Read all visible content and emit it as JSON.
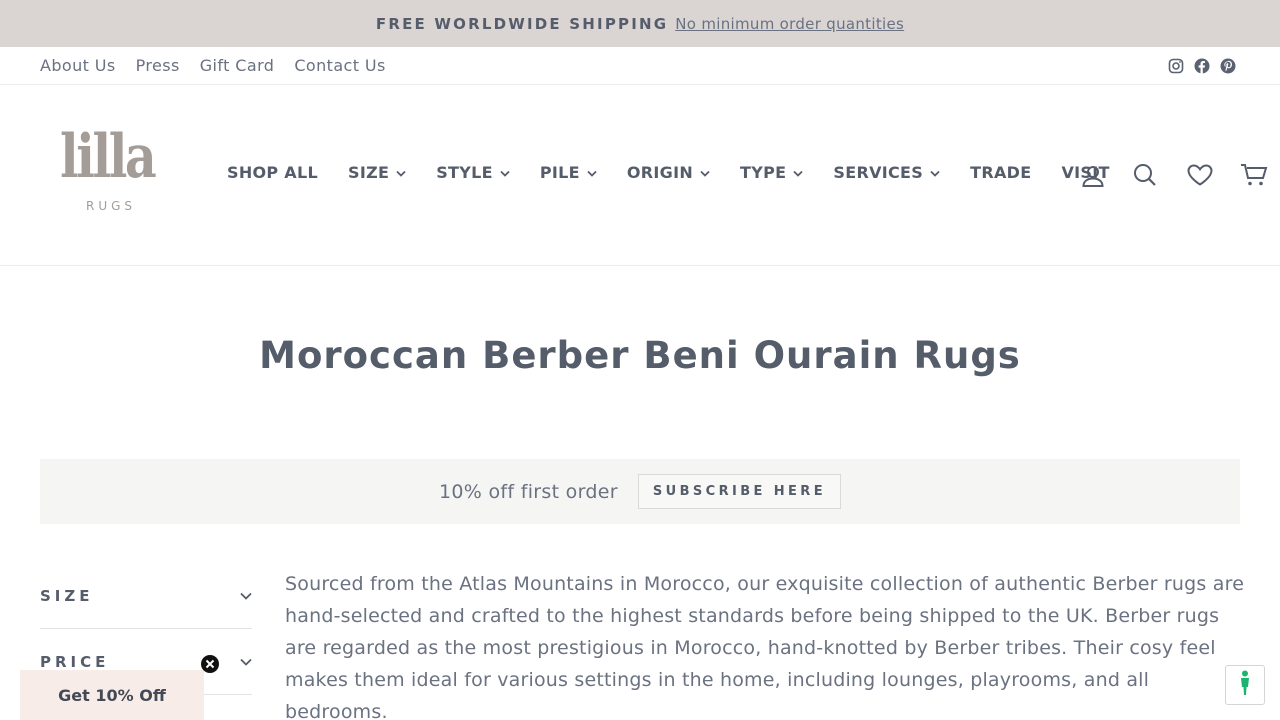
{
  "announcement": {
    "strong": "FREE WORLDWIDE SHIPPING",
    "link": "No minimum order quantities"
  },
  "utility": {
    "links": [
      "About Us",
      "Press",
      "Gift Card",
      "Contact Us"
    ],
    "social": [
      "instagram-icon",
      "facebook-icon",
      "pinterest-icon"
    ]
  },
  "logo": {
    "word": "lilla",
    "sub": "RUGS"
  },
  "nav": {
    "items": [
      {
        "label": "SHOP ALL",
        "dropdown": false
      },
      {
        "label": "SIZE",
        "dropdown": true
      },
      {
        "label": "STYLE",
        "dropdown": true
      },
      {
        "label": "PILE",
        "dropdown": true
      },
      {
        "label": "ORIGIN",
        "dropdown": true
      },
      {
        "label": "TYPE",
        "dropdown": true
      },
      {
        "label": "SERVICES",
        "dropdown": true
      },
      {
        "label": "TRADE",
        "dropdown": false
      },
      {
        "label": "VISIT",
        "dropdown": false
      }
    ],
    "icons": [
      "account-icon",
      "search-icon",
      "heart-icon",
      "cart-icon"
    ]
  },
  "page": {
    "title": "Moroccan Berber Beni Ourain Rugs"
  },
  "promo": {
    "text": "10% off first order",
    "button": "SUBSCRIBE HERE"
  },
  "filters": [
    {
      "label": "SIZE"
    },
    {
      "label": "PRICE"
    }
  ],
  "description": "Sourced from the Atlas Mountains in Morocco, our exquisite collection of authentic Berber rugs are hand-selected and crafted to the highest standards before being shipped to the UK. Berber rugs are regarded as the most prestigious in Morocco, hand-knotted by Berber tribes. Their cosy feel makes them ideal for various settings in the home, including lounges, playrooms, and all bedrooms.",
  "discount_tab": {
    "label": "Get 10% Off"
  },
  "colors": {
    "announcement_bg": "#dad5d3",
    "text": "#555c6a",
    "logo": "#a39c97",
    "promo_bg": "#f5f5f4",
    "discount_bg": "#f7ece8",
    "accessibility_accent": "#1bb36d"
  }
}
